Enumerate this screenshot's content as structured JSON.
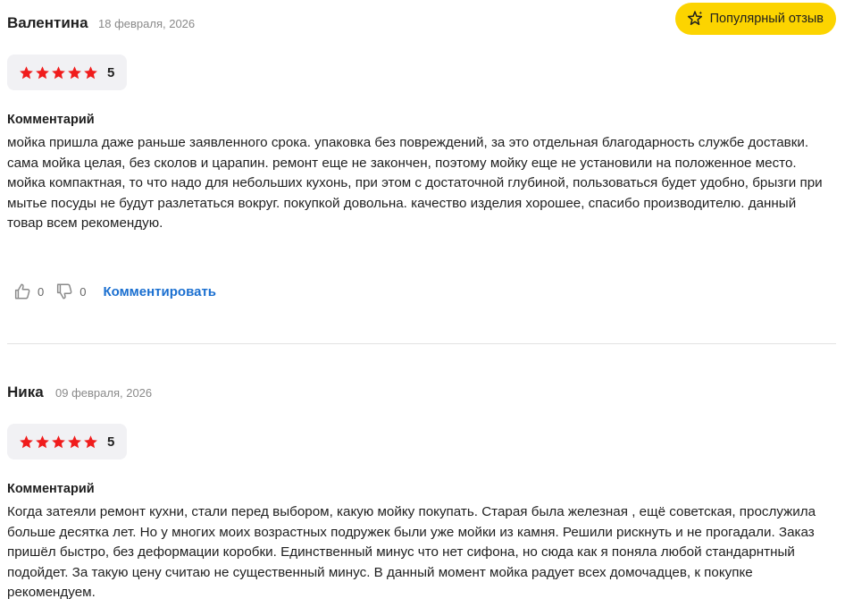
{
  "reviews": [
    {
      "author": "Валентина",
      "date": "18 февраля, 2026",
      "rating": 5,
      "rating_label": "5",
      "badge": "Популярный отзыв",
      "comment_label": "Комментарий",
      "comment": "мойка пришла даже раньше заявленного срока. упаковка без повреждений, за это отдельная благодарность службе доставки. сама мойка целая, без сколов и царапин. ремонт еще не закончен, поэтому мойку еще не установили на положенное место. мойка компактная, то что надо для небольших кухонь, при этом с достаточной глубиной, пользоваться будет удобно, брызги при мытье посуды не будут разлетаться вокруг. покупкой довольна. качество изделия хорошее, спасибо производителю. данный товар всем рекомендую.",
      "likes": "0",
      "dislikes": "0",
      "comment_action": "Комментировать"
    },
    {
      "author": "Ника",
      "date": "09 февраля, 2026",
      "rating": 5,
      "rating_label": "5",
      "comment_label": "Комментарий",
      "comment": "Когда затеяли ремонт кухни, стали перед выбором, какую мойку покупать. Старая была железная , ещё советская, прослужила больше десятка лет. Но у многих моих возрастных подружек были уже мойки из камня. Решили рискнуть и не прогадали. Заказ пришёл быстро, без деформации коробки. Единственный минус что нет сифона, но сюда как я поняла любой стандарнтный подойдет. За такую цену считаю не существенный минус. В данный момент мойка радует всех домочадцев, к покупке рекомендуем."
    }
  ],
  "colors": {
    "star": "#f01c1c",
    "badge": "#fcd400",
    "link": "#1a6fd0",
    "rating_bg": "#f1f1f4"
  },
  "icons": {
    "badge": "sparkle-star-icon",
    "rating": "star-icon",
    "like": "thumbs-up-icon",
    "dislike": "thumbs-down-icon"
  }
}
